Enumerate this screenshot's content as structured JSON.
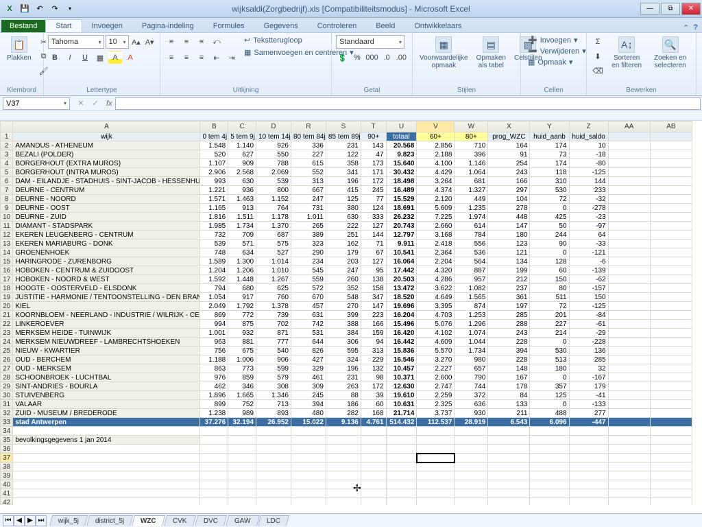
{
  "titlebar": {
    "title": "wijksaldi(Zorgbedrijf).xls  [Compatibiliteitsmodus] - Microsoft Excel"
  },
  "ribbon": {
    "file": "Bestand",
    "tabs": [
      "Start",
      "Invoegen",
      "Pagina-indeling",
      "Formules",
      "Gegevens",
      "Controleren",
      "Beeld",
      "Ontwikkelaars"
    ],
    "groups": {
      "clipboard": {
        "label": "Klembord",
        "paste": "Plakken"
      },
      "font": {
        "label": "Lettertype",
        "name": "Tahoma",
        "size": "10"
      },
      "align": {
        "label": "Uitlijning",
        "wrap": "Tekstterugloop",
        "merge": "Samenvoegen en centreren"
      },
      "number": {
        "label": "Getal",
        "format": "Standaard"
      },
      "styles": {
        "label": "Stijlen",
        "cond": "Voorwaardelijke opmaak",
        "table": "Opmaken als tabel",
        "cell": "Celstijlen"
      },
      "cells": {
        "label": "Cellen",
        "insert": "Invoegen",
        "delete": "Verwijderen",
        "format": "Opmaak"
      },
      "editing": {
        "label": "Bewerken",
        "sort": "Sorteren en filteren",
        "find": "Zoeken en selecteren"
      }
    }
  },
  "namebox": "V37",
  "columns": [
    "",
    "A",
    "B",
    "C",
    "D",
    "R",
    "S",
    "T",
    "U",
    "V",
    "W",
    "X",
    "Y",
    "Z",
    "AA",
    "AB"
  ],
  "headers": {
    "A": "wijk",
    "B": "0 tem 4j",
    "C": "5 tem 9j",
    "D": "10 tem 14j",
    "R": "80 tem 84j",
    "S": "85 tem 89j",
    "T": "90+",
    "U": "totaal",
    "V": "60+",
    "W": "80+",
    "X": "prog_WZC",
    "Y": "huid_aanb",
    "Z": "huid_saldo"
  },
  "rows": [
    {
      "n": 2,
      "A": "AMANDUS - ATHENEUM",
      "B": "1.548",
      "C": "1.140",
      "D": "926",
      "R": "336",
      "S": "231",
      "T": "143",
      "U": "20.568",
      "V": "2.856",
      "W": "710",
      "X": "164",
      "Y": "174",
      "Z": "10"
    },
    {
      "n": 3,
      "A": "BEZALI (POLDER)",
      "B": "520",
      "C": "627",
      "D": "550",
      "R": "227",
      "S": "122",
      "T": "47",
      "U": "9.823",
      "V": "2.188",
      "W": "396",
      "X": "91",
      "Y": "73",
      "Z": "-18"
    },
    {
      "n": 4,
      "A": "BORGERHOUT (EXTRA MUROS)",
      "B": "1.107",
      "C": "909",
      "D": "788",
      "R": "615",
      "S": "358",
      "T": "173",
      "U": "15.640",
      "V": "4.100",
      "W": "1.146",
      "X": "254",
      "Y": "174",
      "Z": "-80"
    },
    {
      "n": 5,
      "A": "BORGERHOUT (INTRA MUROS)",
      "B": "2.906",
      "C": "2.568",
      "D": "2.069",
      "R": "552",
      "S": "341",
      "T": "171",
      "U": "30.432",
      "V": "4.429",
      "W": "1.064",
      "X": "243",
      "Y": "118",
      "Z": "-125"
    },
    {
      "n": 6,
      "A": "DAM - EILANDJE - STADHUIS - SINT-JACOB - HESSENHUIS",
      "B": "993",
      "C": "630",
      "D": "539",
      "R": "313",
      "S": "196",
      "T": "172",
      "U": "18.498",
      "V": "3.264",
      "W": "681",
      "X": "166",
      "Y": "310",
      "Z": "144"
    },
    {
      "n": 7,
      "A": "DEURNE - CENTRUM",
      "B": "1.221",
      "C": "936",
      "D": "800",
      "R": "667",
      "S": "415",
      "T": "245",
      "U": "16.489",
      "V": "4.374",
      "W": "1.327",
      "X": "297",
      "Y": "530",
      "Z": "233"
    },
    {
      "n": 8,
      "A": "DEURNE - NOORD",
      "B": "1.571",
      "C": "1.463",
      "D": "1.152",
      "R": "247",
      "S": "125",
      "T": "77",
      "U": "15.529",
      "V": "2.120",
      "W": "449",
      "X": "104",
      "Y": "72",
      "Z": "-32"
    },
    {
      "n": 9,
      "A": "DEURNE - OOST",
      "B": "1.165",
      "C": "913",
      "D": "764",
      "R": "731",
      "S": "380",
      "T": "124",
      "U": "18.691",
      "V": "5.609",
      "W": "1.235",
      "X": "278",
      "Y": "0",
      "Z": "-278"
    },
    {
      "n": 10,
      "A": "DEURNE - ZUID",
      "B": "1.816",
      "C": "1.511",
      "D": "1.178",
      "R": "1.011",
      "S": "630",
      "T": "333",
      "U": "26.232",
      "V": "7.225",
      "W": "1.974",
      "X": "448",
      "Y": "425",
      "Z": "-23"
    },
    {
      "n": 11,
      "A": "DIAMANT - STADSPARK",
      "B": "1.985",
      "C": "1.734",
      "D": "1.370",
      "R": "265",
      "S": "222",
      "T": "127",
      "U": "20.743",
      "V": "2.660",
      "W": "614",
      "X": "147",
      "Y": "50",
      "Z": "-97"
    },
    {
      "n": 12,
      "A": "EKEREN LEUGENBERG - CENTRUM",
      "B": "732",
      "C": "709",
      "D": "687",
      "R": "389",
      "S": "251",
      "T": "144",
      "U": "12.797",
      "V": "3.168",
      "W": "784",
      "X": "180",
      "Y": "244",
      "Z": "64"
    },
    {
      "n": 13,
      "A": "EKEREN MARIABURG - DONK",
      "B": "539",
      "C": "571",
      "D": "575",
      "R": "323",
      "S": "162",
      "T": "71",
      "U": "9.911",
      "V": "2.418",
      "W": "556",
      "X": "123",
      "Y": "90",
      "Z": "-33"
    },
    {
      "n": 14,
      "A": "GROENENHOEK",
      "B": "748",
      "C": "634",
      "D": "527",
      "R": "290",
      "S": "179",
      "T": "67",
      "U": "10.541",
      "V": "2.364",
      "W": "536",
      "X": "121",
      "Y": "0",
      "Z": "-121"
    },
    {
      "n": 15,
      "A": "HARINGRODE - ZURENBORG",
      "B": "1.589",
      "C": "1.300",
      "D": "1.014",
      "R": "234",
      "S": "203",
      "T": "127",
      "U": "16.064",
      "V": "2.204",
      "W": "564",
      "X": "134",
      "Y": "128",
      "Z": "-6"
    },
    {
      "n": 16,
      "A": "HOBOKEN - CENTRUM & ZUIDOOST",
      "B": "1.204",
      "C": "1.206",
      "D": "1.010",
      "R": "545",
      "S": "247",
      "T": "95",
      "U": "17.442",
      "V": "4.320",
      "W": "887",
      "X": "199",
      "Y": "60",
      "Z": "-139"
    },
    {
      "n": 17,
      "A": "HOBOKEN - NOORD & WEST",
      "B": "1.592",
      "C": "1.448",
      "D": "1.267",
      "R": "559",
      "S": "260",
      "T": "138",
      "U": "20.503",
      "V": "4.286",
      "W": "957",
      "X": "212",
      "Y": "150",
      "Z": "-62"
    },
    {
      "n": 18,
      "A": "HOOGTE - OOSTERVELD - ELSDONK",
      "B": "794",
      "C": "680",
      "D": "625",
      "R": "572",
      "S": "352",
      "T": "158",
      "U": "13.472",
      "V": "3.622",
      "W": "1.082",
      "X": "237",
      "Y": "80",
      "Z": "-157"
    },
    {
      "n": 19,
      "A": "JUSTITIE - HARMONIE / TENTOONSTELLING - DEN BRANDT",
      "B": "1.054",
      "C": "917",
      "D": "760",
      "R": "670",
      "S": "548",
      "T": "347",
      "U": "18.520",
      "V": "4.649",
      "W": "1.565",
      "X": "361",
      "Y": "511",
      "Z": "150"
    },
    {
      "n": 20,
      "A": "KIEL",
      "B": "2.049",
      "C": "1.792",
      "D": "1.378",
      "R": "457",
      "S": "270",
      "T": "147",
      "U": "19.696",
      "V": "3.395",
      "W": "874",
      "X": "197",
      "Y": "72",
      "Z": "-125"
    },
    {
      "n": 21,
      "A": "KOORNBLOEM - NEERLAND - INDUSTRIE / WILRIJK - CENTRUM",
      "B": "869",
      "C": "772",
      "D": "739",
      "R": "631",
      "S": "399",
      "T": "223",
      "U": "16.204",
      "V": "4.703",
      "W": "1.253",
      "X": "285",
      "Y": "201",
      "Z": "-84"
    },
    {
      "n": 22,
      "A": "LINKEROEVER",
      "B": "994",
      "C": "875",
      "D": "702",
      "R": "742",
      "S": "388",
      "T": "166",
      "U": "15.496",
      "V": "5.076",
      "W": "1.296",
      "X": "288",
      "Y": "227",
      "Z": "-61"
    },
    {
      "n": 23,
      "A": "MERKSEM HEIDE - TUINWIJK",
      "B": "1.001",
      "C": "932",
      "D": "871",
      "R": "531",
      "S": "384",
      "T": "159",
      "U": "16.420",
      "V": "4.102",
      "W": "1.074",
      "X": "243",
      "Y": "214",
      "Z": "-29"
    },
    {
      "n": 24,
      "A": "MERKSEM NIEUWDREEF - LAMBRECHTSHOEKEN",
      "B": "963",
      "C": "881",
      "D": "777",
      "R": "644",
      "S": "306",
      "T": "94",
      "U": "16.442",
      "V": "4.609",
      "W": "1.044",
      "X": "228",
      "Y": "0",
      "Z": "-228"
    },
    {
      "n": 25,
      "A": "NIEUW - KWARTIER",
      "B": "756",
      "C": "675",
      "D": "540",
      "R": "826",
      "S": "595",
      "T": "313",
      "U": "15.836",
      "V": "5.570",
      "W": "1.734",
      "X": "394",
      "Y": "530",
      "Z": "136"
    },
    {
      "n": 26,
      "A": "OUD - BERCHEM",
      "B": "1.188",
      "C": "1.006",
      "D": "906",
      "R": "427",
      "S": "324",
      "T": "229",
      "U": "16.546",
      "V": "3.270",
      "W": "980",
      "X": "228",
      "Y": "513",
      "Z": "285"
    },
    {
      "n": 27,
      "A": "OUD - MERKSEM",
      "B": "863",
      "C": "773",
      "D": "599",
      "R": "329",
      "S": "196",
      "T": "132",
      "U": "10.457",
      "V": "2.227",
      "W": "657",
      "X": "148",
      "Y": "180",
      "Z": "32"
    },
    {
      "n": 28,
      "A": "SCHOONBROEK - LUCHTBAL",
      "B": "976",
      "C": "859",
      "D": "579",
      "R": "461",
      "S": "231",
      "T": "98",
      "U": "10.371",
      "V": "2.600",
      "W": "790",
      "X": "167",
      "Y": "0",
      "Z": "-167"
    },
    {
      "n": 29,
      "A": "SINT-ANDRIES - BOURLA",
      "B": "462",
      "C": "346",
      "D": "308",
      "R": "309",
      "S": "263",
      "T": "172",
      "U": "12.630",
      "V": "2.747",
      "W": "744",
      "X": "178",
      "Y": "357",
      "Z": "179"
    },
    {
      "n": 30,
      "A": "STUIVENBERG",
      "B": "1.896",
      "C": "1.665",
      "D": "1.346",
      "R": "245",
      "S": "88",
      "T": "39",
      "U": "19.610",
      "V": "2.259",
      "W": "372",
      "X": "84",
      "Y": "125",
      "Z": "-41"
    },
    {
      "n": 31,
      "A": "VALAAR",
      "B": "899",
      "C": "752",
      "D": "713",
      "R": "394",
      "S": "186",
      "T": "60",
      "U": "10.631",
      "V": "2.325",
      "W": "636",
      "X": "133",
      "Y": "0",
      "Z": "-133"
    },
    {
      "n": 32,
      "A": "ZUID - MUSEUM / BREDERODE",
      "B": "1.238",
      "C": "989",
      "D": "893",
      "R": "480",
      "S": "282",
      "T": "168",
      "U": "21.714",
      "V": "3.737",
      "W": "930",
      "X": "211",
      "Y": "488",
      "Z": "277"
    },
    {
      "n": 33,
      "A": "stad Antwerpen",
      "B": "37.276",
      "C": "32.194",
      "D": "26.952",
      "R": "15.022",
      "S": "9.136",
      "T": "4.761",
      "U": "514.432",
      "V": "112.537",
      "W": "28.919",
      "X": "6.543",
      "Y": "6.096",
      "Z": "-447",
      "total": true
    }
  ],
  "extra": {
    "35": "bevolkingsgegevens 1 jan 2014"
  },
  "sheets": [
    "wijk_5j",
    "district_5j",
    "WZC",
    "CVK",
    "DVC",
    "GAW",
    "LDC"
  ]
}
